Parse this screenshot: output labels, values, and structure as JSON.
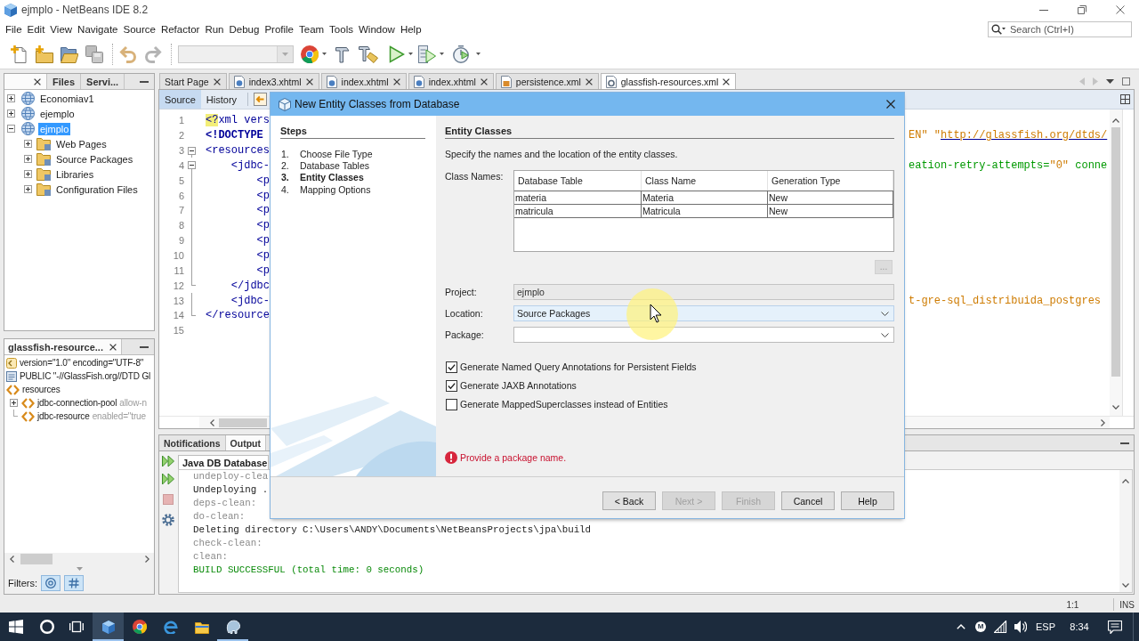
{
  "window": {
    "title": "ejmplo - NetBeans IDE 8.2"
  },
  "menu": [
    "File",
    "Edit",
    "View",
    "Navigate",
    "Source",
    "Refactor",
    "Run",
    "Debug",
    "Profile",
    "Team",
    "Tools",
    "Window",
    "Help"
  ],
  "search": {
    "placeholder": "Search (Ctrl+I)"
  },
  "projects_panel": {
    "tabs": [
      {
        "selected": true
      },
      {
        "label": "Files",
        "selected": false
      },
      {
        "label": "Servi...",
        "selected": false
      }
    ],
    "tree": [
      {
        "label": "Economiav1",
        "kind": "project",
        "expanded": false,
        "selected": false
      },
      {
        "label": "ejemplo",
        "kind": "project",
        "expanded": false,
        "selected": false
      },
      {
        "label": "ejmplo",
        "kind": "project",
        "expanded": true,
        "selected": true,
        "children": [
          {
            "label": "Web Pages",
            "kind": "folder",
            "expanded": false,
            "selected": false
          },
          {
            "label": "Source Packages",
            "kind": "folder",
            "expanded": false,
            "selected": false
          },
          {
            "label": "Libraries",
            "kind": "folder",
            "expanded": false,
            "selected": false
          },
          {
            "label": "Configuration Files",
            "kind": "folder",
            "expanded": false,
            "selected": false
          }
        ]
      }
    ]
  },
  "navigator": {
    "tab": "glassfish-resource...",
    "items": [
      {
        "kind": "declaration",
        "label": "version=\"1.0\" encoding=\"UTF-8\""
      },
      {
        "kind": "doctype",
        "label": "PUBLIC \"-//GlassFish.org//DTD Gl"
      },
      {
        "kind": "element",
        "label": "resources",
        "children": [
          {
            "kind": "element",
            "label": "jdbc-connection-pool",
            "attributes": "allow-n",
            "expanded": false
          },
          {
            "kind": "element",
            "label": "jdbc-resource",
            "attributes": "enabled=\"true"
          }
        ]
      }
    ],
    "filters_label": "Filters:",
    "filters": [
      {
        "kind": "ring",
        "selected": true
      },
      {
        "kind": "hash",
        "selected": true
      }
    ]
  },
  "editor": {
    "tabs": [
      {
        "label": "Start Page",
        "kind": "page",
        "selected": false
      },
      {
        "label": "index3.xhtml",
        "kind": "web",
        "selected": false
      },
      {
        "label": "index.xhtml",
        "kind": "web",
        "selected": false
      },
      {
        "label": "index.xhtml",
        "kind": "web",
        "selected": false
      },
      {
        "label": "persistence.xml",
        "kind": "persistence",
        "selected": false
      },
      {
        "label": "glassfish-resources.xml",
        "kind": "config",
        "selected": true
      }
    ],
    "views": [
      {
        "label": "Source",
        "selected": true
      },
      {
        "label": "History",
        "selected": false
      }
    ],
    "lines": [
      {
        "number": "1",
        "kind": "plain",
        "code": [
          {
            "kind": "marked",
            "text": "<?"
          },
          {
            "kind": "tag",
            "text": "xml vers"
          }
        ]
      },
      {
        "number": "2",
        "kind": "plain",
        "code": [
          {
            "kind": "doctype",
            "text": "<!DOCTYPE"
          }
        ],
        "tail": [
          {
            "kind": "value",
            "text": "EN\" \""
          },
          {
            "kind": "link",
            "text": "http://glassfish.org/dtds/"
          }
        ]
      },
      {
        "number": "3",
        "kind": "opener",
        "code": [
          {
            "kind": "tag",
            "text": "<resources"
          }
        ]
      },
      {
        "number": "4",
        "kind": "opener",
        "code": [
          {
            "kind": "tag",
            "text": "    <jdbc-"
          }
        ],
        "tail": [
          {
            "kind": "attr",
            "text": "eation-retry-attempts="
          },
          {
            "kind": "value",
            "text": "\"0\""
          },
          {
            "kind": "attr",
            "text": " conne"
          }
        ]
      },
      {
        "number": "5",
        "kind": "plain",
        "code": [
          {
            "kind": "tag",
            "text": "        <p"
          }
        ]
      },
      {
        "number": "6",
        "kind": "plain",
        "code": [
          {
            "kind": "tag",
            "text": "        <p"
          }
        ]
      },
      {
        "number": "7",
        "kind": "plain",
        "code": [
          {
            "kind": "tag",
            "text": "        <p"
          }
        ]
      },
      {
        "number": "8",
        "kind": "plain",
        "code": [
          {
            "kind": "tag",
            "text": "        <p"
          }
        ]
      },
      {
        "number": "9",
        "kind": "plain",
        "code": [
          {
            "kind": "tag",
            "text": "        <p"
          }
        ]
      },
      {
        "number": "10",
        "kind": "plain",
        "code": [
          {
            "kind": "tag",
            "text": "        <p"
          }
        ]
      },
      {
        "number": "11",
        "kind": "plain",
        "code": [
          {
            "kind": "tag",
            "text": "        <p"
          }
        ]
      },
      {
        "number": "12",
        "kind": "closer",
        "code": [
          {
            "kind": "tag",
            "text": "    </jdbc"
          }
        ]
      },
      {
        "number": "13",
        "kind": "plain",
        "code": [
          {
            "kind": "tag",
            "text": "    <jdbc-"
          }
        ],
        "tail": [
          {
            "kind": "value",
            "text": "t-gre-sql_distribuida_postgres"
          }
        ]
      },
      {
        "number": "14",
        "kind": "closer",
        "code": [
          {
            "kind": "tag",
            "text": "</resource"
          }
        ]
      },
      {
        "number": "15",
        "kind": "plain"
      }
    ]
  },
  "output": {
    "tabs": [
      {
        "label": "Notifications",
        "selected": false
      },
      {
        "label": "Output",
        "selected": true
      }
    ],
    "console_tab": "Java DB Database",
    "lines": [
      {
        "kind": "target",
        "text": "undeploy-clea"
      },
      {
        "kind": "message",
        "text": "Undeploying ."
      },
      {
        "kind": "target",
        "text": "deps-clean:"
      },
      {
        "kind": "target",
        "text": "do-clean:"
      },
      {
        "kind": "message",
        "text": "Deleting directory C:\\Users\\ANDY\\Documents\\NetBeansProjects\\jpa\\build"
      },
      {
        "kind": "target",
        "text": "check-clean:"
      },
      {
        "kind": "target",
        "text": "clean:"
      },
      {
        "kind": "success",
        "text": "BUILD SUCCESSFUL (total time: 0 seconds)"
      }
    ]
  },
  "dialog": {
    "title": "New Entity Classes from Database",
    "steps_title": "Steps",
    "steps": [
      {
        "number": "1.",
        "label": "Choose File Type",
        "selected": false
      },
      {
        "number": "2.",
        "label": "Database Tables",
        "selected": false
      },
      {
        "number": "3.",
        "label": "Entity Classes",
        "selected": true
      },
      {
        "number": "4.",
        "label": "Mapping Options",
        "selected": false
      }
    ],
    "heading": "Entity Classes",
    "description": "Specify the names and the location of the entity classes.",
    "class_names_label": "Class Names:",
    "table": {
      "columns": [
        "Database Table",
        "Class Name",
        "Generation Type"
      ],
      "rows": [
        [
          "materia",
          "Materia",
          "New"
        ],
        [
          "matricula",
          "Matricula",
          "New"
        ]
      ]
    },
    "browse_button": {
      "label": "...",
      "disabled": true
    },
    "fields": [
      {
        "label": "Project:",
        "kind": "readonly",
        "value": "ejmplo"
      },
      {
        "label": "Location:",
        "kind": "combo",
        "value": "Source Packages"
      },
      {
        "label": "Package:",
        "kind": "editable-combo"
      }
    ],
    "options": [
      {
        "label": "Generate Named Query Annotations for Persistent Fields",
        "checked": true
      },
      {
        "label": "Generate JAXB Annotations",
        "checked": true
      },
      {
        "label": "Generate MappedSuperclasses instead of Entities",
        "checked": false
      }
    ],
    "error": "Provide a package name.",
    "buttons": [
      {
        "label": "< Back",
        "disabled": false
      },
      {
        "label": "Next >",
        "disabled": true
      },
      {
        "label": "Finish",
        "disabled": true
      },
      {
        "label": "Cancel",
        "disabled": false
      },
      {
        "label": "Help",
        "disabled": false
      }
    ]
  },
  "status_bar": {
    "position": "1:1",
    "mode": "INS"
  },
  "taskbar": {
    "apps": [
      {
        "kind": "cube",
        "active": true,
        "running": true
      },
      {
        "kind": "ball",
        "active": false,
        "running": false
      },
      {
        "kind": "letter",
        "active": false,
        "running": false
      },
      {
        "kind": "folder",
        "active": false,
        "running": false
      },
      {
        "kind": "elephant",
        "active": false,
        "running": true
      }
    ],
    "tray_badge": "M",
    "language": "ESP",
    "clock": "8:34"
  }
}
